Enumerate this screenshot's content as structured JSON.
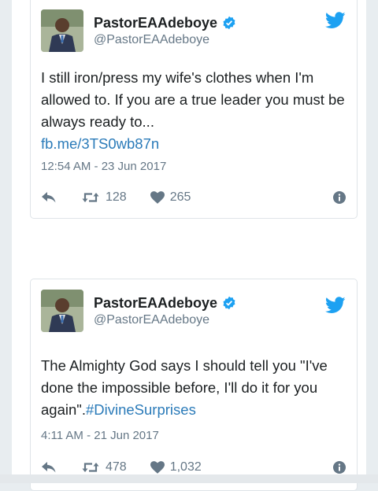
{
  "tweets": [
    {
      "display_name": "PastorEAAdeboye",
      "handle": "@PastorEAAdeboye",
      "text": "I still iron/press my wife's clothes when I'm allowed to. If you are a true leader you must be always ready to...",
      "link": "fb.me/3TS0wb87n",
      "timestamp": "12:54 AM - 23 Jun 2017",
      "retweets": "128",
      "likes": "265"
    },
    {
      "display_name": "PastorEAAdeboye",
      "handle": "@PastorEAAdeboye",
      "text": "The Almighty God says I should tell you \"I've done the impossible before, I'll do it for you again\".",
      "hashtag": "#DivineSurprises",
      "timestamp": "4:11 AM - 21 Jun 2017",
      "retweets": "478",
      "likes": "1,032"
    }
  ],
  "colors": {
    "twitter_blue": "#1da1f2",
    "link": "#2b7bb9",
    "text": "#1c2022",
    "muted": "#657786"
  },
  "icons": [
    "avatar-photo",
    "verified-badge-icon",
    "twitter-bird-icon",
    "reply-icon",
    "retweet-icon",
    "heart-icon",
    "info-icon"
  ]
}
